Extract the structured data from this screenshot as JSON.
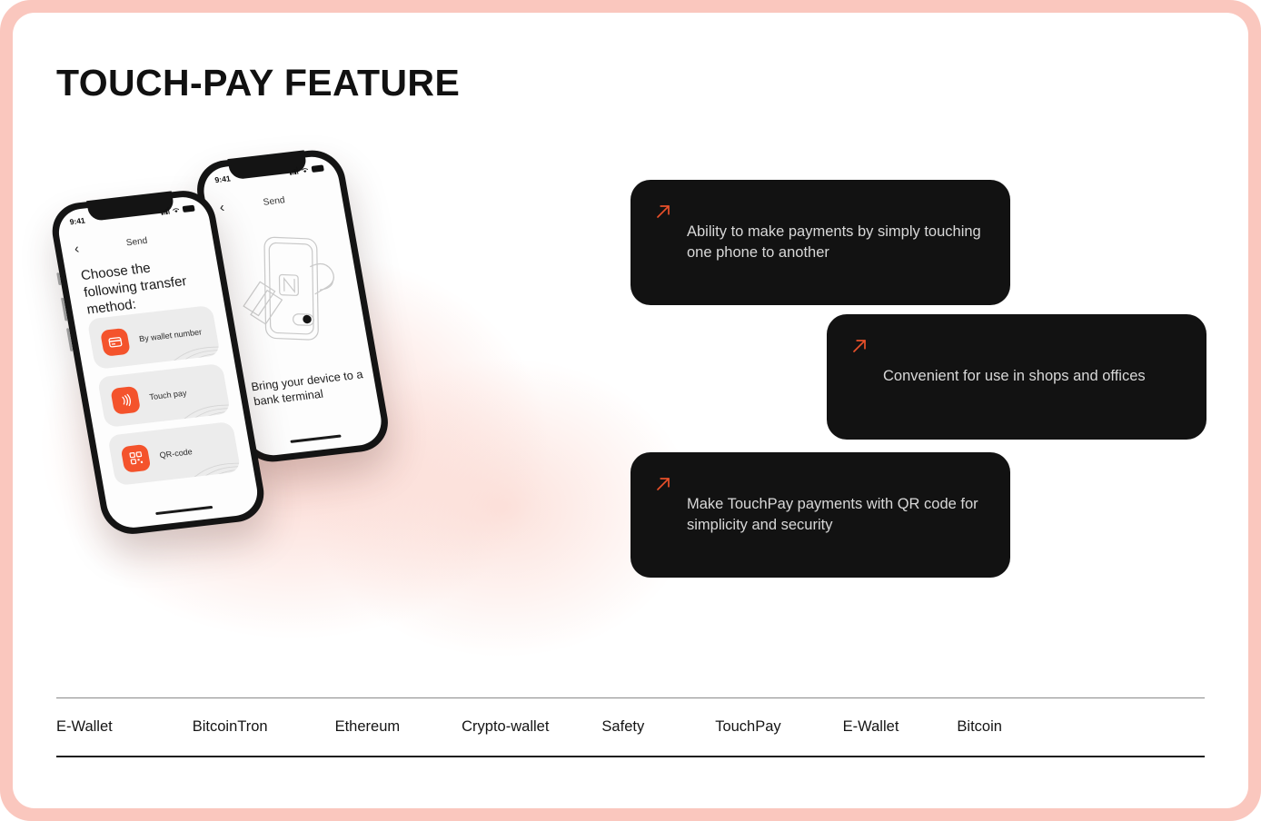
{
  "slide": {
    "title": "TOUCH-PAY FEATURE",
    "frame_color": "#fac7be",
    "card_bg": "#121212",
    "accent_color": "#e8502a",
    "tile_color": "#f4532c",
    "card_text_color": "#d8d8d8"
  },
  "features": [
    {
      "icon": "arrow-up-right-icon",
      "text": "Ability to make payments by simply touching one phone to another"
    },
    {
      "icon": "arrow-up-right-icon",
      "text": "Convenient for use in shops and offices"
    },
    {
      "icon": "arrow-up-right-icon",
      "text": "Make TouchPay payments with QR code for simplicity and security"
    }
  ],
  "phone_front": {
    "status_time": "9:41",
    "status_icons": [
      "signal-icon",
      "wifi-icon",
      "battery-icon"
    ],
    "back_icon": "chevron-left-icon",
    "nav_title": "Send",
    "heading": "Choose the following transfer method:",
    "methods": [
      {
        "icon": "wallet-card-icon",
        "label": "By wallet number"
      },
      {
        "icon": "touch-pay-waves-icon",
        "label": "Touch pay"
      },
      {
        "icon": "qr-code-icon",
        "label": "QR-code"
      }
    ]
  },
  "phone_back": {
    "status_time": "9:41",
    "back_icon": "chevron-left-icon",
    "nav_title": "Send",
    "illustration": "nfc-phone-terminal-icon",
    "caption": "Bring your device to a bank terminal"
  },
  "keywords": [
    "E-Wallet",
    "Bitcoin",
    "Tron",
    "Ethereum",
    "Crypto-wallet",
    "Safety",
    "TouchPay",
    "E-Wallet",
    "Bitcoin"
  ]
}
